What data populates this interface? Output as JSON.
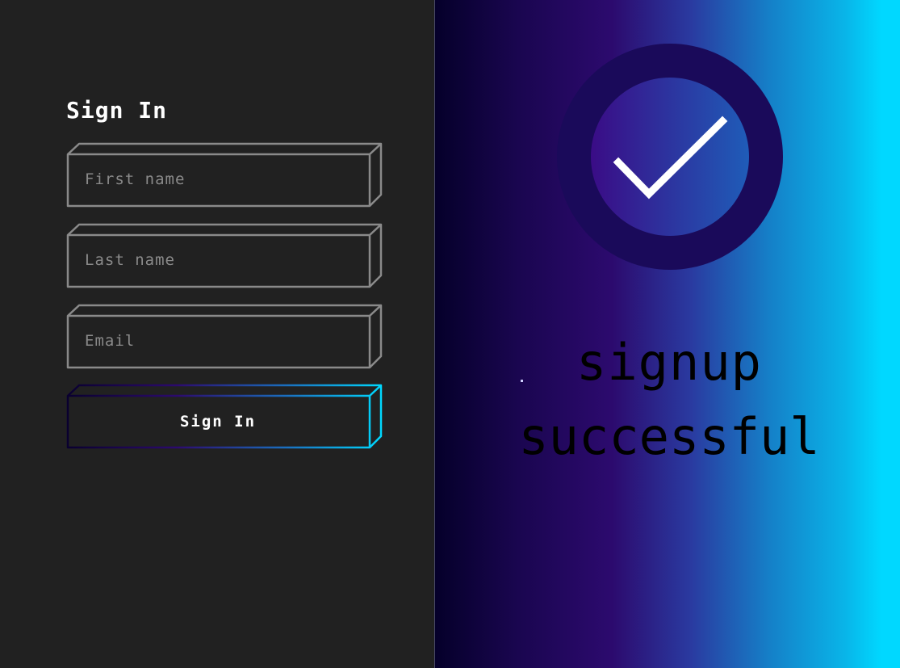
{
  "form": {
    "title": "Sign In",
    "fields": {
      "first_name": {
        "placeholder": "First name",
        "value": ""
      },
      "last_name": {
        "placeholder": "Last name",
        "value": ""
      },
      "email": {
        "placeholder": "Email",
        "value": ""
      }
    },
    "submit_label": "Sign In"
  },
  "success_panel": {
    "line1": "signup",
    "line2": "successful",
    "icon": "checkmark-circle-icon"
  },
  "colors": {
    "background": "#212121",
    "field_border": "#8a8a8a",
    "gradient_start": "#05002a",
    "gradient_mid": "#2c0a6e",
    "gradient_end": "#00d8ff",
    "ring": "#1a0a5a"
  }
}
